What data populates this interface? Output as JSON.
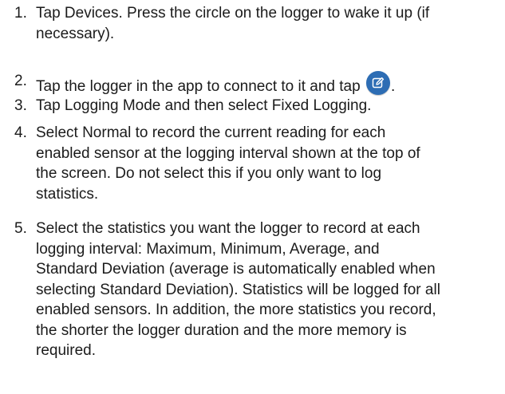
{
  "steps": [
    {
      "number": "1.",
      "lines": [
        "Tap Devices. Press the circle on the logger to wake it up (if",
        "necessary)."
      ]
    },
    {
      "number": "2.",
      "text_before_icon": "Tap the logger in the app to connect to it and tap",
      "icon": "edit-pencil-icon",
      "icon_color": "#2d6db4",
      "text_after_icon": "."
    },
    {
      "number": "3.",
      "lines": [
        "Tap Logging Mode and then select Fixed Logging."
      ]
    },
    {
      "number": "4.",
      "lines": [
        "Select Normal to record the current reading for each",
        "enabled sensor at the logging interval shown at the top of",
        "the screen. Do not select this if you only want to log",
        "statistics."
      ]
    },
    {
      "number": "5.",
      "lines": [
        "Select the statistics you want the logger to record at each",
        "logging interval: Maximum, Minimum, Average, and",
        "Standard Deviation (average is automatically enabled when",
        "selecting Standard Deviation). Statistics will be logged for all",
        "enabled sensors. In addition, the more statistics you record,",
        "the shorter the logger duration and the more memory is",
        "required."
      ]
    }
  ]
}
